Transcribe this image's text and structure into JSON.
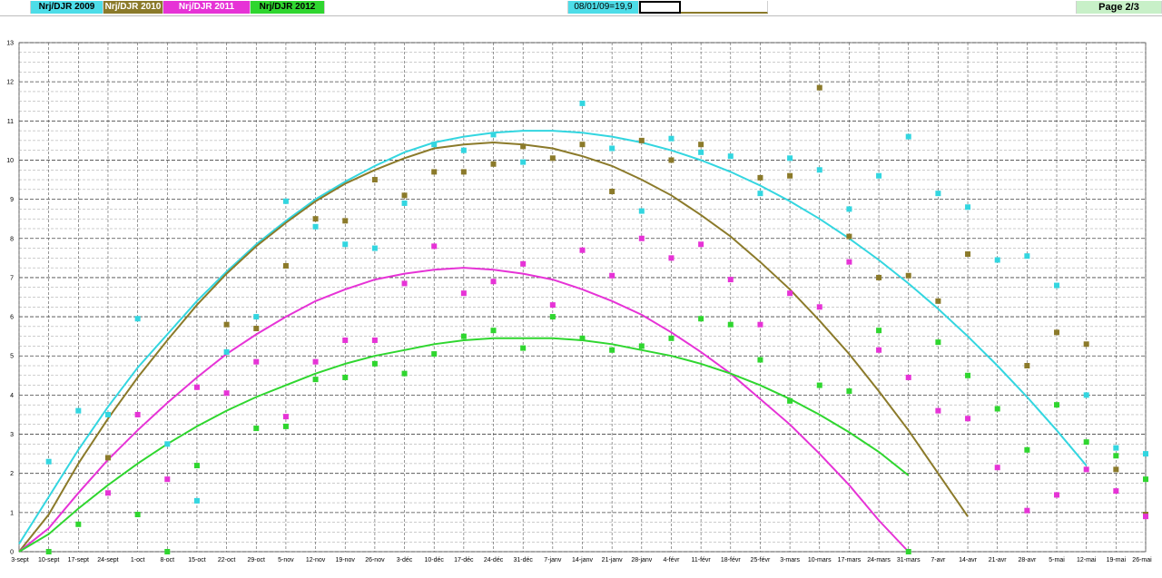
{
  "topbar": {
    "legend": [
      {
        "label": "Nrj/DJR 2009",
        "bg": "#4ddde8",
        "fg": "#000000"
      },
      {
        "label": "Nrj/DJR 2010",
        "bg": "#8b7a2a",
        "fg": "#ffffff"
      },
      {
        "label": "Nrj/DJR 2011",
        "bg": "#e633d6",
        "fg": "#ffffff"
      },
      {
        "label": "Nrj/DJR 2012",
        "bg": "#2fd62f",
        "fg": "#000000"
      }
    ],
    "info": "08/01/09=19,9",
    "page": "Page  2/3"
  },
  "chart_data": {
    "type": "scatter",
    "categories": [
      "3-sept",
      "10-sept",
      "17-sept",
      "24-sept",
      "1-oct",
      "8-oct",
      "15-oct",
      "22-oct",
      "29-oct",
      "5-nov",
      "12-nov",
      "19-nov",
      "26-nov",
      "3-déc",
      "10-déc",
      "17-déc",
      "24-déc",
      "31-déc",
      "7-janv",
      "14-janv",
      "21-janv",
      "28-janv",
      "4-févr",
      "11-févr",
      "18-févr",
      "25-févr",
      "3-mars",
      "10-mars",
      "17-mars",
      "24-mars",
      "31-mars",
      "7-avr",
      "14-avr",
      "21-avr",
      "28-avr",
      "5-mai",
      "12-mai",
      "19-mai",
      "26-mai"
    ],
    "ylim": [
      0,
      13
    ],
    "yticks": [
      0,
      1,
      2,
      3,
      4,
      5,
      6,
      7,
      8,
      9,
      10,
      11,
      12,
      13
    ],
    "grid": true,
    "series": [
      {
        "name": "Nrj/DJR 2009",
        "color": "#33d6e0",
        "values": [
          null,
          2.3,
          3.6,
          3.5,
          5.95,
          2.75,
          1.3,
          5.1,
          6.0,
          8.95,
          8.3,
          7.85,
          7.75,
          8.9,
          10.4,
          10.25,
          10.65,
          9.95,
          null,
          11.45,
          10.3,
          8.7,
          10.55,
          10.2,
          10.1,
          9.15,
          10.05,
          9.75,
          8.75,
          9.6,
          10.6,
          9.15,
          8.8,
          7.45,
          7.55,
          6.8,
          4.0,
          2.65,
          2.5
        ],
        "trend": [
          0.2,
          1.4,
          2.6,
          3.7,
          4.7,
          5.55,
          6.4,
          7.15,
          7.85,
          8.45,
          9.0,
          9.45,
          9.85,
          10.2,
          10.45,
          10.6,
          10.7,
          10.75,
          10.75,
          10.7,
          10.6,
          10.45,
          10.25,
          10.0,
          9.7,
          9.35,
          8.95,
          8.5,
          8.0,
          7.45,
          6.85,
          6.2,
          5.5,
          4.75,
          3.95,
          3.1,
          2.2
        ]
      },
      {
        "name": "Nrj/DJR 2010",
        "color": "#8b7a2a",
        "values": [
          null,
          null,
          null,
          2.4,
          null,
          null,
          null,
          5.8,
          5.7,
          7.3,
          8.5,
          8.45,
          9.5,
          9.1,
          9.7,
          9.7,
          9.9,
          10.35,
          10.05,
          10.4,
          9.2,
          10.5,
          10.0,
          10.4,
          null,
          9.55,
          9.6,
          11.85,
          8.05,
          7.0,
          7.05,
          6.4,
          7.6,
          null,
          4.75,
          5.6,
          5.3,
          2.1,
          0.95
        ],
        "trend": [
          -0.2,
          0.95,
          2.25,
          3.4,
          4.45,
          5.4,
          6.3,
          7.1,
          7.8,
          8.4,
          8.95,
          9.4,
          9.75,
          10.05,
          10.3,
          10.4,
          10.45,
          10.4,
          10.3,
          10.1,
          9.85,
          9.5,
          9.1,
          8.6,
          8.05,
          7.4,
          6.7,
          5.9,
          5.05,
          4.1,
          3.1,
          2.0,
          0.9
        ]
      },
      {
        "name": "Nrj/DJR 2011",
        "color": "#e633d6",
        "values": [
          null,
          null,
          null,
          1.5,
          3.5,
          1.85,
          4.2,
          4.05,
          4.85,
          3.45,
          4.85,
          5.4,
          5.4,
          6.85,
          7.8,
          6.6,
          6.9,
          7.35,
          6.3,
          7.7,
          7.05,
          8.0,
          7.5,
          7.85,
          6.95,
          5.8,
          6.6,
          6.25,
          7.4,
          5.15,
          4.45,
          3.6,
          3.4,
          2.15,
          1.05,
          1.45,
          2.1,
          1.55,
          0.9
        ],
        "trend": [
          -0.2,
          0.6,
          1.5,
          2.35,
          3.1,
          3.8,
          4.45,
          5.05,
          5.55,
          6.0,
          6.4,
          6.7,
          6.95,
          7.1,
          7.2,
          7.25,
          7.2,
          7.1,
          6.95,
          6.7,
          6.4,
          6.05,
          5.6,
          5.1,
          4.55,
          3.9,
          3.25,
          2.5,
          1.7,
          0.8,
          0.0
        ]
      },
      {
        "name": "Nrj/DJR 2012",
        "color": "#2fd62f",
        "values": [
          null,
          0.0,
          0.7,
          null,
          0.95,
          0.0,
          2.2,
          null,
          3.15,
          3.2,
          4.4,
          4.45,
          4.8,
          4.55,
          5.05,
          5.5,
          5.65,
          5.2,
          6.0,
          5.45,
          5.15,
          5.25,
          5.45,
          5.95,
          5.8,
          4.9,
          3.85,
          4.25,
          4.1,
          5.65,
          0.0,
          5.35,
          4.5,
          3.65,
          2.6,
          3.75,
          2.8,
          2.45,
          1.85
        ],
        "trend": [
          -0.2,
          0.45,
          1.1,
          1.7,
          2.25,
          2.75,
          3.2,
          3.6,
          3.95,
          4.25,
          4.55,
          4.8,
          5.0,
          5.15,
          5.3,
          5.4,
          5.45,
          5.45,
          5.45,
          5.4,
          5.3,
          5.15,
          5.0,
          4.8,
          4.55,
          4.25,
          3.9,
          3.5,
          3.05,
          2.55,
          1.95
        ]
      }
    ]
  }
}
